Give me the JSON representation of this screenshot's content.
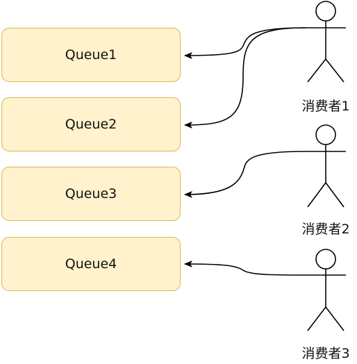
{
  "queues": [
    {
      "label": "Queue1"
    },
    {
      "label": "Queue2"
    },
    {
      "label": "Queue3"
    },
    {
      "label": "Queue4"
    }
  ],
  "consumers": [
    {
      "label": "消费者1"
    },
    {
      "label": "消费者2"
    },
    {
      "label": "消费者3"
    }
  ],
  "colors": {
    "queue_fill": "#fff2cc",
    "queue_stroke": "#d6b656",
    "line": "#000000",
    "background": "#ffffff"
  },
  "icons": {
    "consumer": "stick-figure-icon",
    "arrowhead": "arrowhead-icon"
  }
}
